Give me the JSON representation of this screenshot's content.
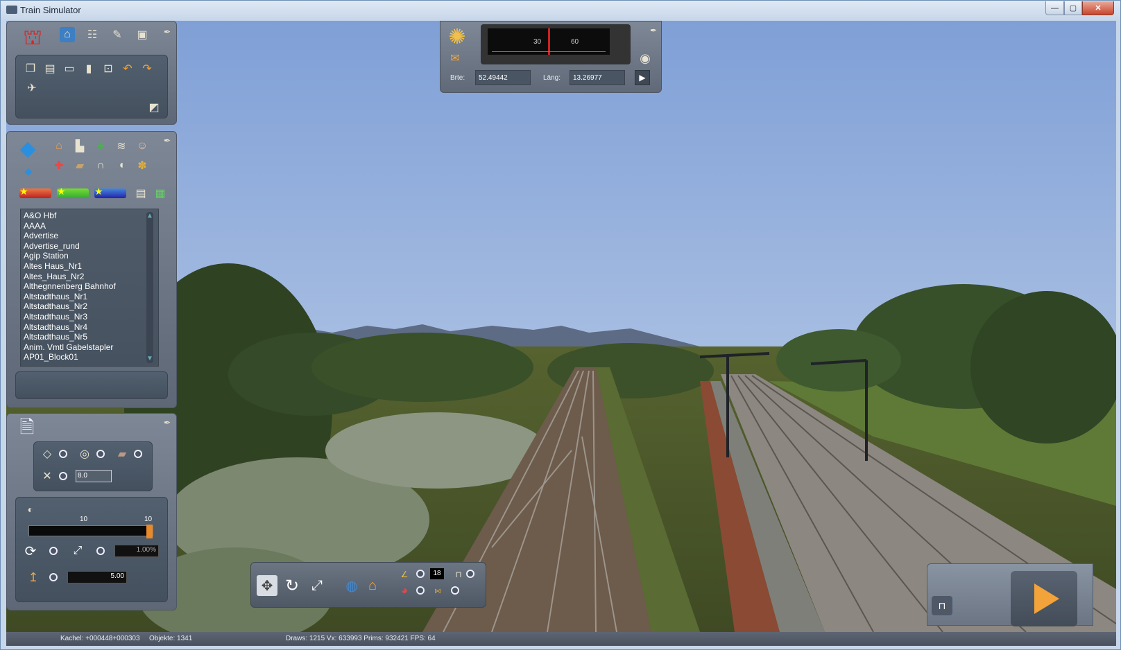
{
  "window": {
    "title": "Train Simulator",
    "minimize": "—",
    "maximize": "▢",
    "close": "✕"
  },
  "map_nav": {
    "gauge_ticks": [
      "30",
      "60"
    ],
    "lat_label": "Brte:",
    "lat_value": "52.49442",
    "lon_label": "Läng:",
    "lon_value": "13.26977"
  },
  "object_list": {
    "items": [
      "A&O Hbf",
      "AAAA",
      "Advertise",
      "Advertise_rund",
      "Agip Station",
      "Altes Haus_Nr1",
      "Altes_Haus_Nr2",
      "Althegnnenberg Bahnhof",
      "Altstadthaus_Nr1",
      "Altstadthaus_Nr2",
      "Altstadthaus_Nr3",
      "Altstadthaus_Nr4",
      "Altstadthaus_Nr5",
      "Anim. Vmtl Gabelstapler",
      "AP01_Block01"
    ]
  },
  "terrain_tool": {
    "spacing_value": "8.0"
  },
  "brush": {
    "label_left": "10",
    "label_right": "10",
    "rotate_value": "1.00%",
    "height_value": "5.00"
  },
  "bottom_toolbar": {
    "time_value": "18"
  },
  "status": {
    "tile": "Kachel: +000448+000303",
    "objects": "Objekte: 1341",
    "perf": "Draws: 1215 Vx: 633993 Prims: 932421 FPS: 64"
  },
  "colors": {
    "sky_top": "#7f9fd6",
    "sky_bottom": "#c9d8ec",
    "grass": "#4d5b2c",
    "accent_orange": "#e8892a"
  }
}
